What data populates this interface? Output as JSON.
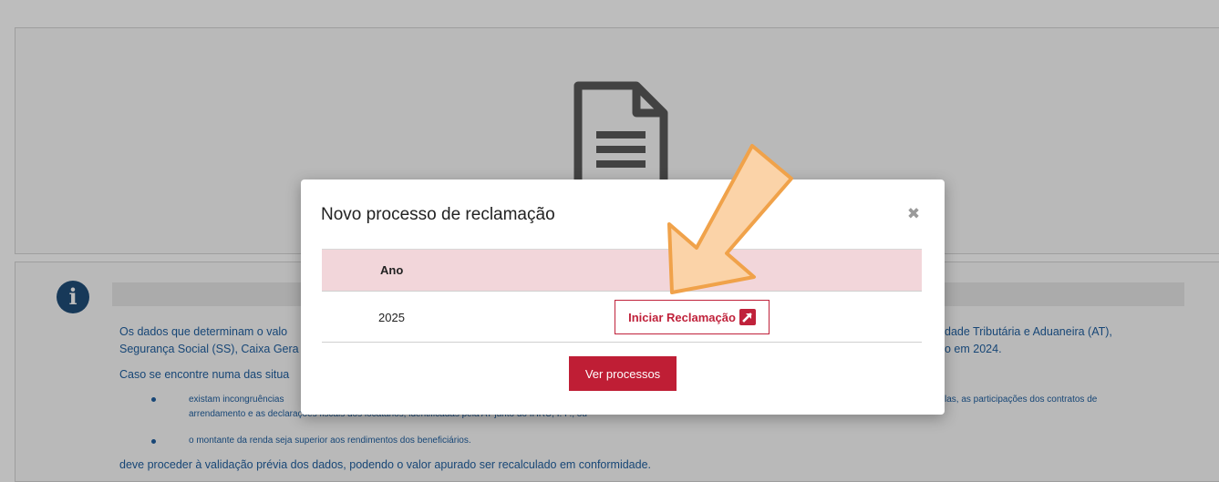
{
  "background": {
    "icons": {
      "document": "document-icon",
      "info": "info-icon"
    },
    "info_glyph": "i",
    "paragraph_1_left": "Os dados que determinam o valo",
    "paragraph_1_right": "dade Tributária e Aduaneira (AT),",
    "paragraph_2_left": "Segurança Social (SS), Caixa Gera",
    "paragraph_2_right": "o em 2024.",
    "paragraph_3": "Caso se encontre numa das situa",
    "bullet_1_left": "existam incongruências",
    "bullet_1_right": "las, as participações dos contratos de",
    "bullet_1_line2": "arrendamento e as declarações fiscais dos locatários, identificadas pela AT junto do IHRU, I. P.; ou",
    "bullet_2": "o montante da renda seja superior aos rendimentos dos beneficiários.",
    "closing": "deve proceder à validação prévia dos dados, podendo o valor apurado ser recalculado em conformidade."
  },
  "modal": {
    "title": "Novo processo de reclamação",
    "close_glyph": "✖",
    "table": {
      "header": "Ano",
      "rows": [
        {
          "year": "2025",
          "action_label": "Iniciar Reclamação",
          "action_icon": "external-link-icon"
        }
      ]
    },
    "primary_button": "Ver processos"
  },
  "colors": {
    "accent": "#bf1e35",
    "header_bg": "#f2d6da",
    "link": "#1f5fa0",
    "annotation_arrow": "#f0a24a"
  }
}
